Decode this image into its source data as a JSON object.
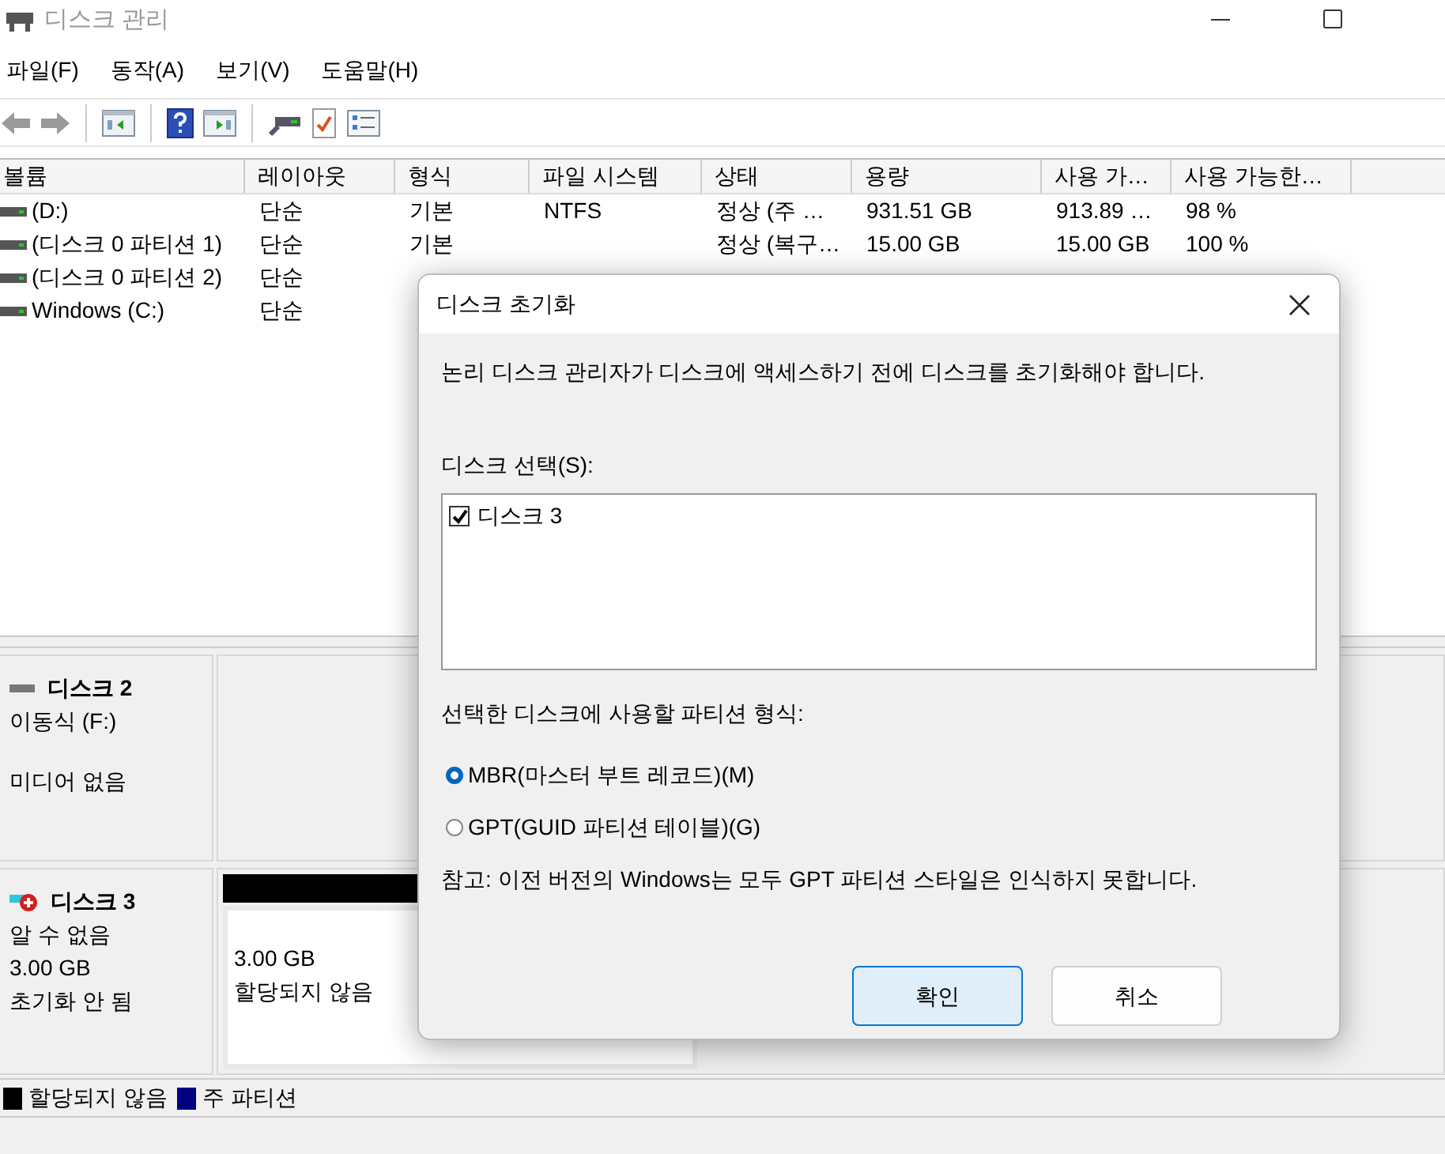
{
  "window": {
    "title": "디스크 관리"
  },
  "menu": [
    {
      "label": "파일(F)"
    },
    {
      "label": "동작(A)"
    },
    {
      "label": "보기(V)"
    },
    {
      "label": "도움말(H)"
    }
  ],
  "volume_table": {
    "columns": [
      "볼륨",
      "레이아웃",
      "형식",
      "파일 시스템",
      "상태",
      "용량",
      "사용 가…",
      "사용 가능한…"
    ],
    "rows": [
      [
        "(D:)",
        "단순",
        "기본",
        "NTFS",
        "정상 (주 …",
        "931.51 GB",
        "913.89 …",
        "98 %"
      ],
      [
        "(디스크 0 파티션 1)",
        "단순",
        "기본",
        null,
        "정상 (복구…",
        "15.00 GB",
        "15.00 GB",
        "100 %"
      ],
      [
        "(디스크 0 파티션 2)",
        "단순"
      ],
      [
        "Windows (C:)",
        "단순"
      ]
    ]
  },
  "disks": [
    {
      "name": "디스크 2",
      "kind": "removable",
      "type": "이동식 (F:)",
      "status": "미디어 없음"
    },
    {
      "name": "디스크 3",
      "kind": "uninitialized",
      "type": "알 수 없음",
      "size": "3.00 GB",
      "status": "초기화 안 됨",
      "partitions": [
        {
          "size": "3.00 GB",
          "label": "할당되지 않음",
          "color": "#000000"
        }
      ]
    }
  ],
  "legend": [
    {
      "label": "할당되지 않음",
      "color": "#000000"
    },
    {
      "label": "주 파티션",
      "color": "#000080"
    }
  ],
  "dialog": {
    "title": "디스크 초기화",
    "message": "논리 디스크 관리자가 디스크에 액세스하기 전에 디스크를 초기화해야 합니다.",
    "list_label": "디스크 선택(S):",
    "disks": [
      {
        "label": "디스크 3",
        "checked": true
      }
    ],
    "style_label": "선택한 디스크에 사용할 파티션 형식:",
    "styles": [
      {
        "label": "MBR(마스터 부트 레코드)(M)",
        "selected": true
      },
      {
        "label": "GPT(GUID 파티션 테이블)(G)",
        "selected": false
      }
    ],
    "note": "참고: 이전 버전의 Windows는 모두 GPT 파티션 스타일은 인식하지 못합니다.",
    "buttons": [
      {
        "label": "확인",
        "kind": "primary"
      },
      {
        "label": "취소",
        "kind": "secondary"
      }
    ]
  }
}
